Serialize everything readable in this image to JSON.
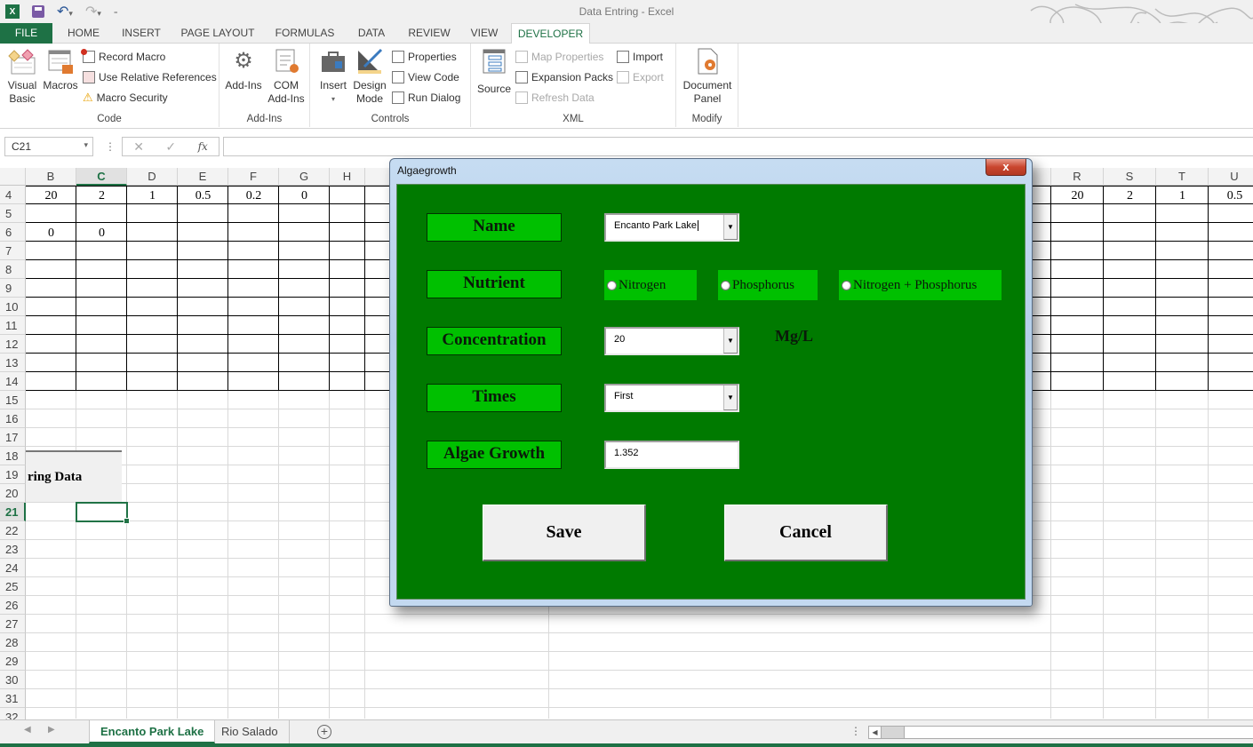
{
  "app": {
    "window_title": "Data Entring - Excel",
    "icons": [
      "excel-logo-icon",
      "save-icon",
      "undo-icon",
      "redo-icon",
      "customize-qat-icon"
    ]
  },
  "ribbon_tabs": [
    "FILE",
    "HOME",
    "INSERT",
    "PAGE LAYOUT",
    "FORMULAS",
    "DATA",
    "REVIEW",
    "VIEW",
    "DEVELOPER"
  ],
  "active_tab": "DEVELOPER",
  "ribbon": {
    "code": {
      "label": "Code",
      "visual_basic": [
        "Visual",
        "Basic"
      ],
      "macros": "Macros",
      "record_macro": "Record Macro",
      "use_relative": "Use Relative References",
      "macro_security": "Macro Security"
    },
    "addins": {
      "label": "Add-Ins",
      "addins": "Add-Ins",
      "com_addins": [
        "COM",
        "Add-Ins"
      ]
    },
    "controls": {
      "label": "Controls",
      "insert": "Insert",
      "design_mode": [
        "Design",
        "Mode"
      ],
      "properties": "Properties",
      "view_code": "View Code",
      "run_dialog": "Run Dialog"
    },
    "xml": {
      "label": "XML",
      "source": "Source",
      "map_properties": "Map Properties",
      "expansion_packs": "Expansion Packs",
      "refresh_data": "Refresh Data",
      "import": "Import",
      "export": "Export"
    },
    "modify": {
      "label": "Modify",
      "document_panel": [
        "Document",
        "Panel"
      ]
    }
  },
  "formula_bar": {
    "name_box": "C21",
    "cancel_icon": "✕",
    "enter_icon": "✓",
    "fx": "fx",
    "formula": ""
  },
  "sheet": {
    "columns_left": [
      "B",
      "C",
      "D",
      "E",
      "F",
      "G",
      "H"
    ],
    "columns_right": [
      "R",
      "S",
      "T",
      "U"
    ],
    "selected_column": "C",
    "rows": [
      "4",
      "5",
      "6",
      "7",
      "8",
      "9",
      "10",
      "11",
      "12",
      "13",
      "14",
      "15",
      "16",
      "17",
      "18",
      "19",
      "20",
      "21",
      "22",
      "23",
      "24",
      "25",
      "26",
      "27",
      "28",
      "29",
      "30",
      "31",
      "32"
    ],
    "selected_row": "21",
    "row4_left": [
      "20",
      "2",
      "1",
      "0.5",
      "0.2",
      "0"
    ],
    "row6_left": [
      "0",
      "0"
    ],
    "row4_right": [
      "20",
      "2",
      "1",
      "0.5"
    ],
    "sheet_button_label": "ring Data"
  },
  "sheet_tabs": {
    "tabs": [
      "Encanto Park Lake",
      "Rio Salado"
    ],
    "active": "Encanto Park Lake"
  },
  "dialog": {
    "title": "Algaegrowth",
    "close": "x",
    "labels": {
      "name": "Name",
      "nutrient": "Nutrient",
      "concentration": "Concentration",
      "times": "Times",
      "algae_growth": "Algae Growth"
    },
    "name_value": "Encanto Park Lake",
    "nutrient_options": [
      "Nitrogen",
      "Phosphorus",
      "Nitrogen + Phosphorus"
    ],
    "nutrient_selected": null,
    "concentration_value": "20",
    "concentration_unit": "Mg/L",
    "times_value": "First",
    "algae_growth_value": "1.352",
    "save": "Save",
    "cancel": "Cancel",
    "colors": {
      "body": "#007a00",
      "label_bg": "#00c000"
    }
  }
}
